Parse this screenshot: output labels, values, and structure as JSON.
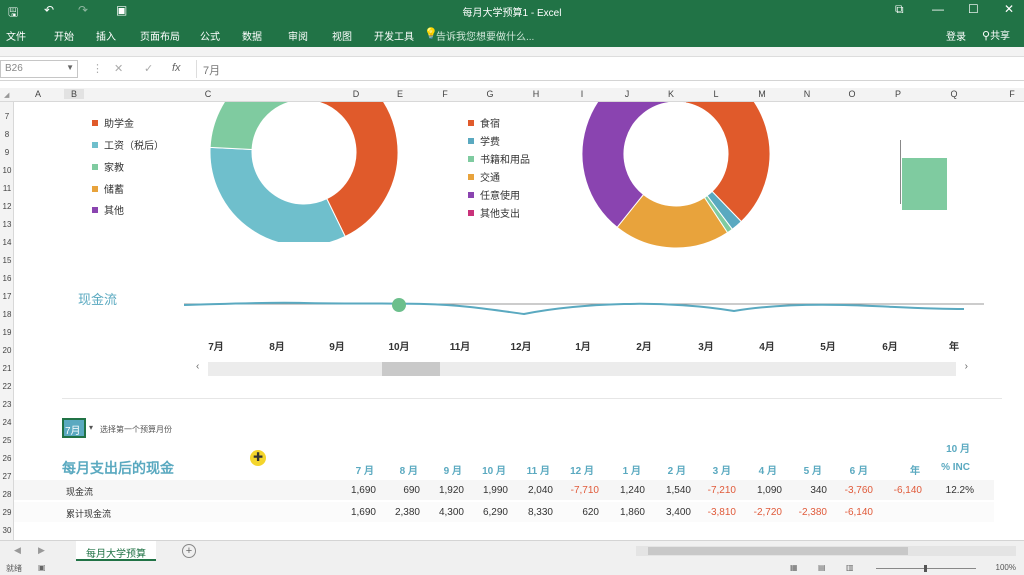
{
  "window": {
    "title": "每月大学预算1 - Excel",
    "controls": {
      "restore": "⧉",
      "minimize": "—",
      "maximize": "☐",
      "close": "✕"
    }
  },
  "ribbon": {
    "tabs": [
      "文件",
      "开始",
      "插入",
      "页面布局",
      "公式",
      "数据",
      "审阅",
      "视图",
      "开发工具"
    ],
    "tell_me": "告诉我您想要做什么...",
    "sign_in": "登录",
    "share": "共享"
  },
  "formula_bar": {
    "name_box": "B26",
    "value": "7月",
    "icons": {
      "cancel": "✕",
      "enter": "✓",
      "fx": "fx"
    }
  },
  "columns": [
    "A",
    "B",
    "C",
    "D",
    "E",
    "F",
    "G",
    "H",
    "I",
    "J",
    "K",
    "L",
    "M",
    "N",
    "O",
    "P",
    "Q",
    "F"
  ],
  "rows": [
    "7",
    "8",
    "9",
    "10",
    "11",
    "12",
    "13",
    "14",
    "15",
    "16",
    "17",
    "18",
    "19",
    "20",
    "21",
    "22",
    "23",
    "24",
    "25",
    "26",
    "27",
    "28",
    "29",
    "30"
  ],
  "income_legend": [
    "助学金",
    "工资（税后）",
    "家教",
    "储蓄",
    "其他"
  ],
  "expense_legend": [
    "食宿",
    "学费",
    "书籍和用品",
    "交通",
    "任意使用",
    "其他支出"
  ],
  "colors": {
    "accent_green": "#217346",
    "orange_red": "#e05a2b",
    "teal": "#6fbfcc",
    "mint": "#7fcba0",
    "amber": "#e8a33c",
    "purple": "#8a44b0",
    "pink": "#c9327a",
    "line_blue": "#5aa9c0"
  },
  "chart_data": [
    {
      "type": "pie",
      "values": [
        40,
        33,
        27
      ],
      "categories": [
        "助学金",
        "工资（税后）",
        "家教"
      ]
    },
    {
      "type": "pie",
      "values": [
        35,
        2,
        1,
        20,
        38,
        4
      ],
      "categories": [
        "食宿",
        "学费",
        "书籍和用品",
        "交通",
        "任意使用",
        "其他支出"
      ]
    },
    {
      "type": "line",
      "title": "现金流",
      "categories": [
        "7月",
        "8月",
        "9月",
        "10月",
        "11月",
        "12月",
        "1月",
        "2月",
        "3月",
        "4月",
        "5月",
        "6月",
        "年"
      ]
    }
  ],
  "selector": {
    "value": "7月",
    "hint": "选择第一个预算月份"
  },
  "table": {
    "title": "每月支出后的现金",
    "header_extra": "10 月",
    "headers": [
      "7 月",
      "8 月",
      "9 月",
      "10 月",
      "11 月",
      "12 月",
      "1 月",
      "2 月",
      "3 月",
      "4 月",
      "5 月",
      "6 月",
      "年",
      "% INC"
    ],
    "rows": [
      {
        "label": "现金流",
        "values": [
          "1,690",
          "690",
          "1,920",
          "1,990",
          "2,040",
          "-7,710",
          "1,240",
          "1,540",
          "-7,210",
          "1,090",
          "340",
          "-3,760",
          "-6,140",
          "12.2%"
        ]
      },
      {
        "label": "累计现金流",
        "values": [
          "1,690",
          "2,380",
          "4,300",
          "6,290",
          "8,330",
          "620",
          "1,860",
          "3,400",
          "-3,810",
          "-2,720",
          "-2,380",
          "-6,140"
        ]
      }
    ]
  },
  "sheet_tab": "每月大学预算",
  "status": {
    "ready": "就绪",
    "zoom": "100%"
  }
}
